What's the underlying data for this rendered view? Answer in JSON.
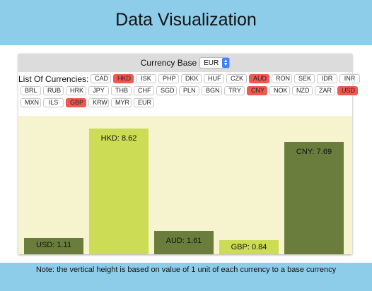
{
  "header": {
    "title": "Data Visualization"
  },
  "controls": {
    "base_label": "Currency Base",
    "base_value": "EUR",
    "list_label": "List Of Currencies:"
  },
  "currencies": [
    {
      "code": "CAD",
      "selected": false
    },
    {
      "code": "HKD",
      "selected": true
    },
    {
      "code": "ISK",
      "selected": false
    },
    {
      "code": "PHP",
      "selected": false
    },
    {
      "code": "DKK",
      "selected": false
    },
    {
      "code": "HUF",
      "selected": false
    },
    {
      "code": "CZK",
      "selected": false
    },
    {
      "code": "AUD",
      "selected": true
    },
    {
      "code": "RON",
      "selected": false
    },
    {
      "code": "SEK",
      "selected": false
    },
    {
      "code": "IDR",
      "selected": false
    },
    {
      "code": "INR",
      "selected": false
    },
    {
      "code": "BRL",
      "selected": false
    },
    {
      "code": "RUB",
      "selected": false
    },
    {
      "code": "HRK",
      "selected": false
    },
    {
      "code": "JPY",
      "selected": false
    },
    {
      "code": "THB",
      "selected": false
    },
    {
      "code": "CHF",
      "selected": false
    },
    {
      "code": "SGD",
      "selected": false
    },
    {
      "code": "PLN",
      "selected": false
    },
    {
      "code": "BGN",
      "selected": false
    },
    {
      "code": "TRY",
      "selected": false
    },
    {
      "code": "CNY",
      "selected": true
    },
    {
      "code": "NOK",
      "selected": false
    },
    {
      "code": "NZD",
      "selected": false
    },
    {
      "code": "ZAR",
      "selected": false
    },
    {
      "code": "USD",
      "selected": true
    },
    {
      "code": "MXN",
      "selected": false
    },
    {
      "code": "ILS",
      "selected": false
    },
    {
      "code": "GBP",
      "selected": true
    },
    {
      "code": "KRW",
      "selected": false
    },
    {
      "code": "MYR",
      "selected": false
    },
    {
      "code": "EUR",
      "selected": false
    }
  ],
  "colors": {
    "chip_active": "#f2584d",
    "bar_dark": "#6b7d3d",
    "bar_light": "#cddc55",
    "chart_bg": "#f6f3cf",
    "page_bg": "#8ecdea"
  },
  "chart_data": {
    "type": "bar",
    "categories": [
      "USD",
      "HKD",
      "AUD",
      "GBP",
      "CNY"
    ],
    "values": [
      1.11,
      8.62,
      1.61,
      0.84,
      7.69
    ],
    "labels": [
      "USD: 1.11",
      "HKD: 8.62",
      "AUD: 1.61",
      "GBP: 0.84",
      "CNY: 7.69"
    ],
    "bar_colors": [
      "#6b7d3d",
      "#cddc55",
      "#6b7d3d",
      "#cddc55",
      "#6b7d3d"
    ],
    "ylim": [
      0,
      9.5
    ]
  },
  "footer": {
    "note": "Note: the vertical height is based on value of 1 unit of each currency to a base currency"
  }
}
